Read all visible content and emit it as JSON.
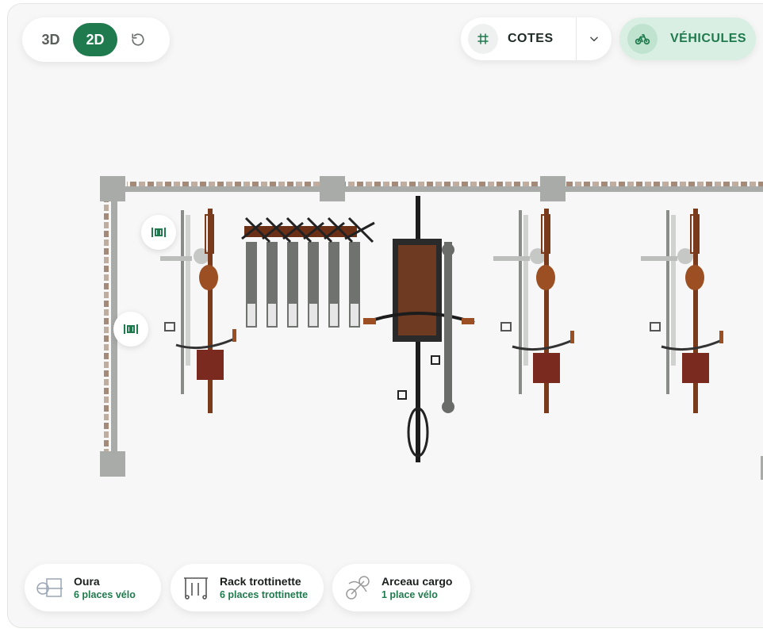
{
  "view_toggle": {
    "btn_3d": "3D",
    "btn_2d": "2D",
    "active": "2D"
  },
  "toolbar": {
    "cotes_label": "COTES",
    "vehicules_label": "VÉHICULES"
  },
  "colors": {
    "accent": "#1f7a4d",
    "accent_light": "#d9efe3",
    "rail": "#a9aba9",
    "bike_brown": "#7a3b1c",
    "basket": "#7a2a1e"
  },
  "products": [
    {
      "name": "Oura",
      "capacity": "6 places vélo"
    },
    {
      "name": "Rack trottinette",
      "capacity": "6 places trottinette"
    },
    {
      "name": "Arceau cargo",
      "capacity": "1 place vélo"
    }
  ]
}
